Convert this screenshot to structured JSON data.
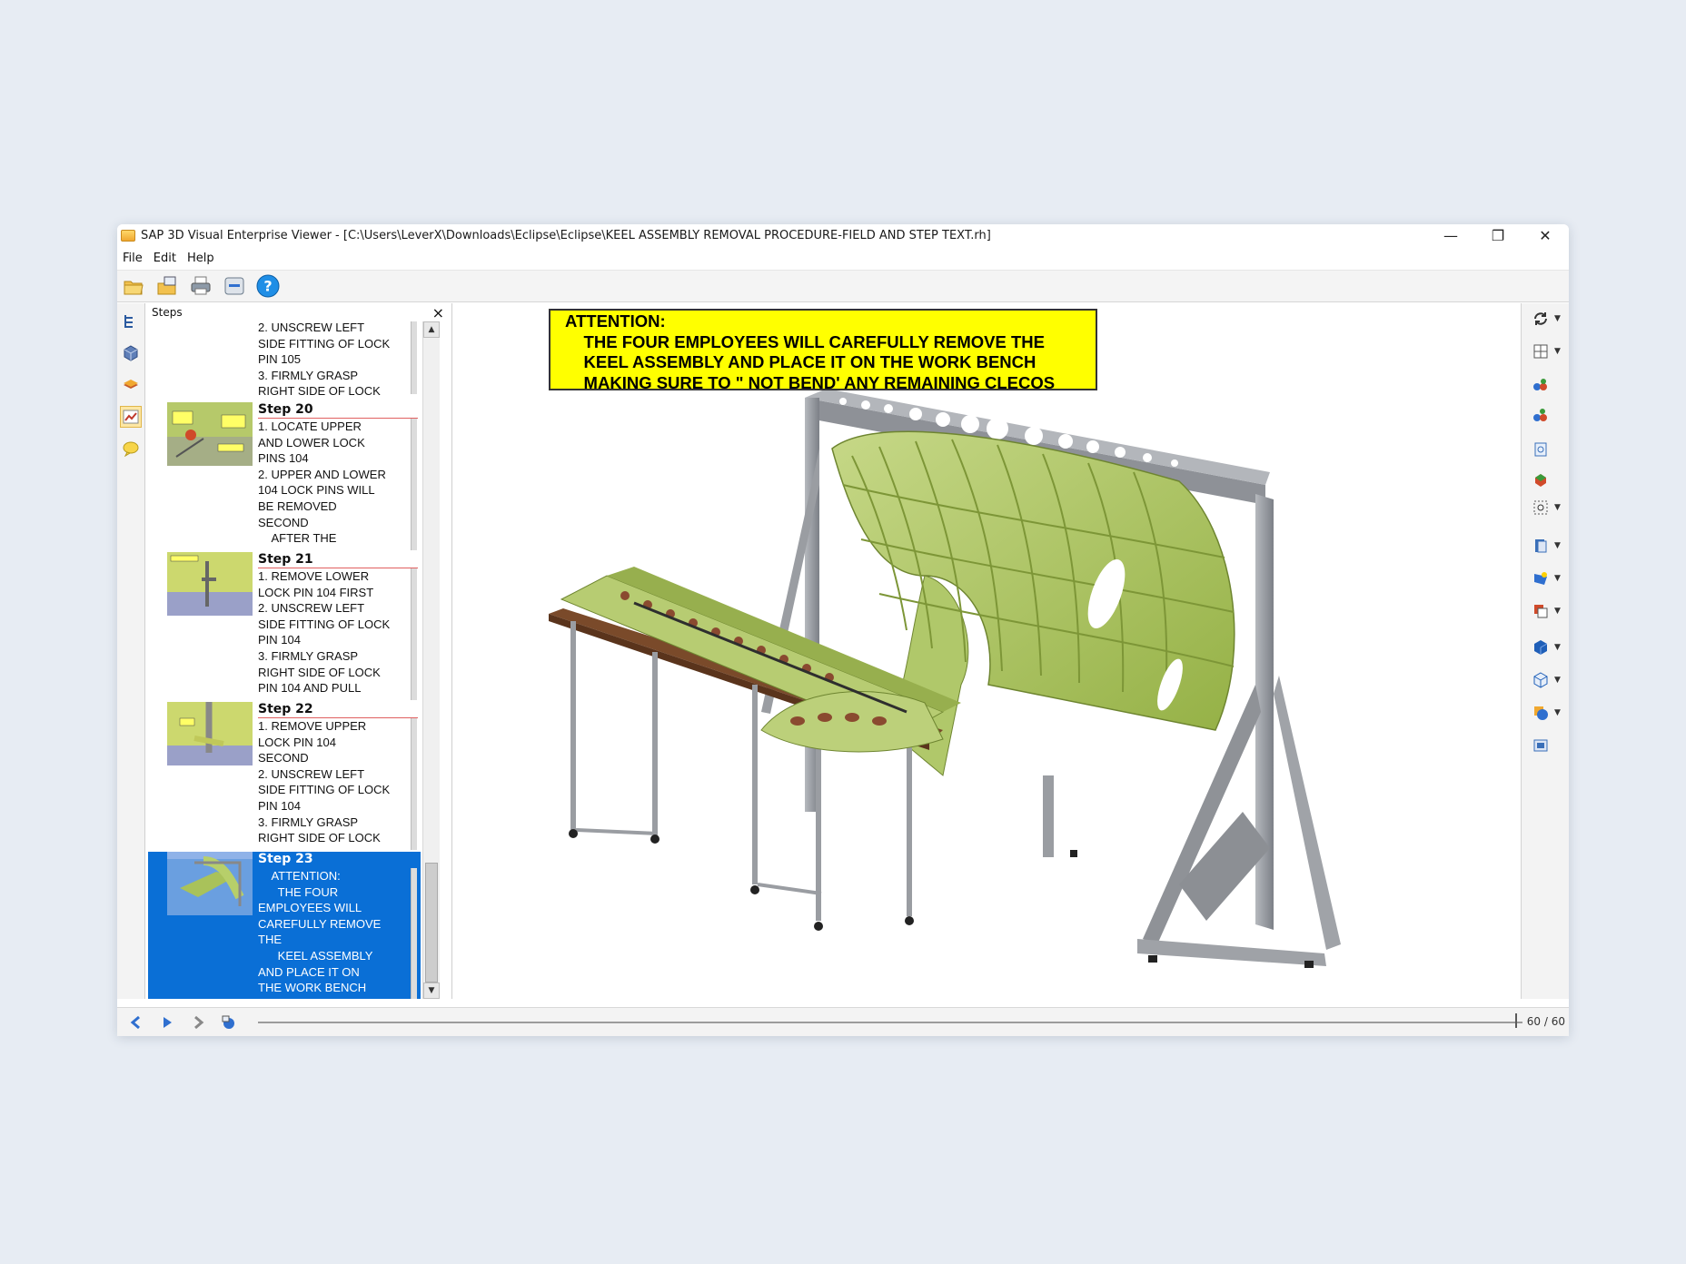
{
  "window": {
    "title": "SAP 3D Visual Enterprise Viewer - [C:\\Users\\LeverX\\Downloads\\Eclipse\\Eclipse\\KEEL ASSEMBLY REMOVAL PROCEDURE-FIELD AND STEP TEXT.rh]",
    "minimize": "—",
    "restore": "❐",
    "close": "✕"
  },
  "menu": {
    "file": "File",
    "edit": "Edit",
    "help": "Help"
  },
  "steps_panel": {
    "title": "Steps",
    "close": "×",
    "items": [
      {
        "title": "",
        "text": "2. UNSCREW LEFT\nSIDE FITTING OF LOCK\nPIN 105\n3. FIRMLY GRASP\nRIGHT SIDE OF LOCK"
      },
      {
        "title": "Step 20",
        "text": "1. LOCATE UPPER\nAND LOWER LOCK\nPINS 104\n2. UPPER AND LOWER\n104 LOCK PINS WILL\nBE REMOVED\nSECOND\n    AFTER THE"
      },
      {
        "title": "Step 21",
        "text": "1. REMOVE LOWER\nLOCK PIN 104 FIRST\n2. UNSCREW LEFT\nSIDE FITTING OF LOCK\nPIN 104\n3. FIRMLY GRASP\nRIGHT SIDE OF LOCK\nPIN 104 AND PULL"
      },
      {
        "title": "Step 22",
        "text": "1. REMOVE UPPER\nLOCK PIN 104\nSECOND\n2. UNSCREW LEFT\nSIDE FITTING OF LOCK\nPIN 104\n3. FIRMLY GRASP\nRIGHT SIDE OF LOCK"
      },
      {
        "title": "Step 23",
        "text": "    ATTENTION:\n      THE FOUR\nEMPLOYEES WILL\nCAREFULLY REMOVE\nTHE\n      KEEL ASSEMBLY\nAND PLACE IT ON\nTHE WORK BENCH"
      }
    ]
  },
  "viewport": {
    "attention_lines": [
      "ATTENTION:",
      "    THE FOUR EMPLOYEES WILL CAREFULLY REMOVE THE",
      "    KEEL ASSEMBLY AND PLACE IT ON THE WORK BENCH",
      "    MAKING SURE TO \" NOT BEND' ANY REMAINING CLECOS"
    ]
  },
  "playback": {
    "counter": "60 / 60"
  },
  "colors": {
    "selection": "#0a6fd6",
    "attention_bg": "#ffff00",
    "part_green": "#a9c25a",
    "frame_grey": "#9b9ea3",
    "bench_brown": "#7a4a2a"
  },
  "icons": {
    "toolbar": [
      "open-icon",
      "import-icon",
      "print-icon",
      "save-icon",
      "help-icon"
    ],
    "left_strip": [
      "scene-tree-icon",
      "model-icon",
      "layers-icon",
      "steps-icon",
      "notes-icon"
    ],
    "right_toolbar": [
      "orbit-icon",
      "view-layout-icon",
      "camera-icon",
      "camera-2-icon",
      "zoom-icon",
      "reset-icon",
      "select-icon",
      "render-icon",
      "lighting-icon",
      "color-icon",
      "shaded-icon",
      "wireframe-icon",
      "materials-icon",
      "fullscreen-icon"
    ],
    "navigation": [
      "previous-icon",
      "play-icon",
      "next-icon",
      "loop-icon"
    ]
  }
}
